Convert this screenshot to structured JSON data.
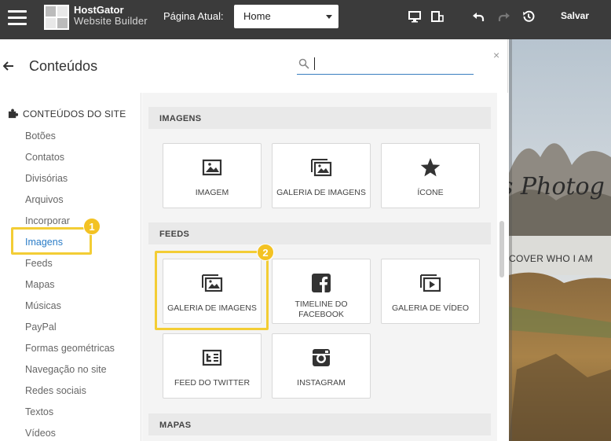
{
  "topbar": {
    "brand_line1": "HostGator",
    "brand_line2": "Website Builder",
    "page_label": "Página Atual:",
    "page_value": "Home",
    "save_label": "Salvar"
  },
  "panel": {
    "title": "Conteúdos",
    "search_value": "",
    "close": "×"
  },
  "sidebar": {
    "title": "CONTEÚDOS DO SITE",
    "items": [
      "Botões",
      "Contatos",
      "Divisórias",
      "Arquivos",
      "Incorporar",
      "Imagens",
      "Feeds",
      "Mapas",
      "Músicas",
      "PayPal",
      "Formas geométricas",
      "Navegação no site",
      "Redes sociais",
      "Textos",
      "Vídeos"
    ]
  },
  "sections": {
    "imagens": {
      "title": "IMAGENS",
      "tiles": [
        "IMAGEM",
        "GALERIA DE IMAGENS",
        "ÍCONE"
      ]
    },
    "feeds": {
      "title": "FEEDS",
      "tiles": [
        "GALERIA DE IMAGENS",
        "TIMELINE DO FACEBOOK",
        "GALERIA DE VÍDEO",
        "FEED DO TWITTER",
        "INSTAGRAM"
      ]
    },
    "mapas": {
      "title": "MAPAS"
    }
  },
  "badges": [
    "1",
    "2"
  ],
  "preview": {
    "title": "s Photog",
    "subtitle": "COVER WHO I AM"
  },
  "icons": {
    "menu": "hamburger-icon",
    "back": "arrow-left-icon",
    "search": "magnifier-icon",
    "image": "image-icon",
    "gallery": "gallery-icon",
    "star": "star-icon",
    "facebook": "facebook-icon",
    "video": "video-gallery-icon",
    "twitter": "twitter-feed-icon",
    "instagram": "instagram-icon"
  },
  "colors": {
    "topbar": "#3b3b3b",
    "accent": "#2a7cc7",
    "highlight": "#f3cd35"
  }
}
